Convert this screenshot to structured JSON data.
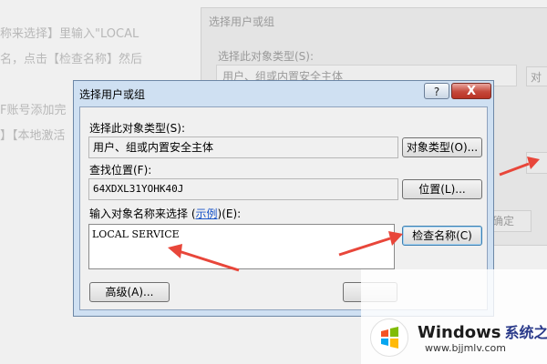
{
  "background": {
    "tutorial_lines": [
      "称来选择】里输入\"LOCAL",
      "名，点击【检查名称】然后",
      "F账号添加完",
      "】【本地激活"
    ],
    "dialog_title": "选择用户或组",
    "dialog_label": "选择此对象类型(S):",
    "dialog_field": "用户、组或内置安全主体",
    "button_edge": "对",
    "button_ok": "确定"
  },
  "dialog": {
    "title": "选择用户或组",
    "help_label": "?",
    "close_label": "X",
    "object_type_label": "选择此对象类型(S):",
    "object_type_value": "用户、组或内置安全主体",
    "object_type_button": "对象类型(O)...",
    "location_label": "查找位置(F):",
    "location_value": "64XDXL31YOHK40J",
    "location_button": "位置(L)...",
    "names_label_prefix": "输入对象名称来选择 (",
    "names_label_link": "示例",
    "names_label_suffix": ")(E):",
    "names_value": "LOCAL SERVICE",
    "check_names_button": "检查名称(C)",
    "advanced_button": "高级(A)..."
  },
  "annotation_color": "#e8463a",
  "watermark": {
    "brand": "Windows",
    "brand_cn": "系统之家",
    "url": "www.bjjmlv.com"
  }
}
